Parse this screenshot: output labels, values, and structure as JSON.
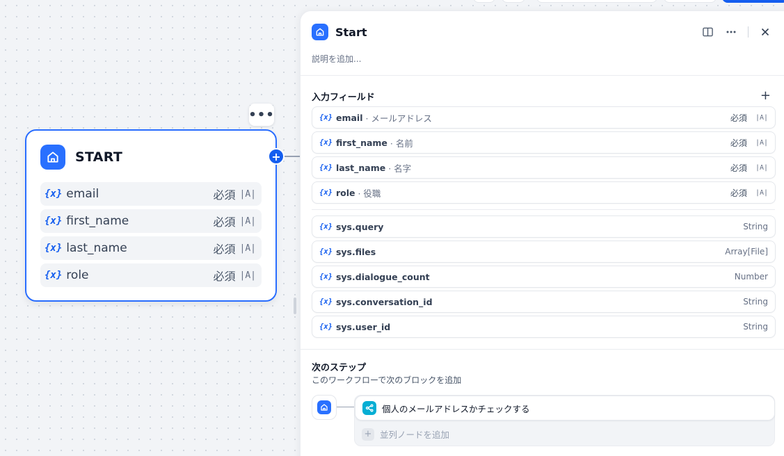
{
  "node": {
    "title": "START",
    "more_label": "•••",
    "fields": [
      {
        "name": "email",
        "required": "必須",
        "type_icon": "|A|"
      },
      {
        "name": "first_name",
        "required": "必須",
        "type_icon": "|A|"
      },
      {
        "name": "last_name",
        "required": "必須",
        "type_icon": "|A|"
      },
      {
        "name": "role",
        "required": "必須",
        "type_icon": "|A|"
      }
    ],
    "var_icon": "{x}",
    "plus_label": "+"
  },
  "panel": {
    "title": "Start",
    "description_placeholder": "説明を追加...",
    "input_section_title": "入力フィールド",
    "add_label": "+",
    "input_fields": [
      {
        "name": "email",
        "label": "· メールアドレス",
        "required": "必須",
        "type_icon": "|A|"
      },
      {
        "name": "first_name",
        "label": "· 名前",
        "required": "必須",
        "type_icon": "|A|"
      },
      {
        "name": "last_name",
        "label": "· 名字",
        "required": "必須",
        "type_icon": "|A|"
      },
      {
        "name": "role",
        "label": "· 役職",
        "required": "必須",
        "type_icon": "|A|"
      }
    ],
    "system_fields": [
      {
        "name": "sys.query",
        "type": "String"
      },
      {
        "name": "sys.files",
        "type": "Array[File]"
      },
      {
        "name": "sys.dialogue_count",
        "type": "Number"
      },
      {
        "name": "sys.conversation_id",
        "type": "String"
      },
      {
        "name": "sys.user_id",
        "type": "String"
      }
    ],
    "next_step": {
      "title": "次のステップ",
      "subtitle": "このワークフローで次のブロックを追加",
      "next_node_label": "個人のメールアドレスかチェックする",
      "add_parallel_label": "並列ノードを追加",
      "add_parallel_icon": "+"
    }
  },
  "icons": {
    "home": "home-icon",
    "branch": "branch-icon",
    "book": "book-icon",
    "more": "more-icon",
    "close": "close-icon"
  },
  "colors": {
    "accent": "#155eef",
    "node_border": "#296dff",
    "branch": "#06aed4"
  }
}
